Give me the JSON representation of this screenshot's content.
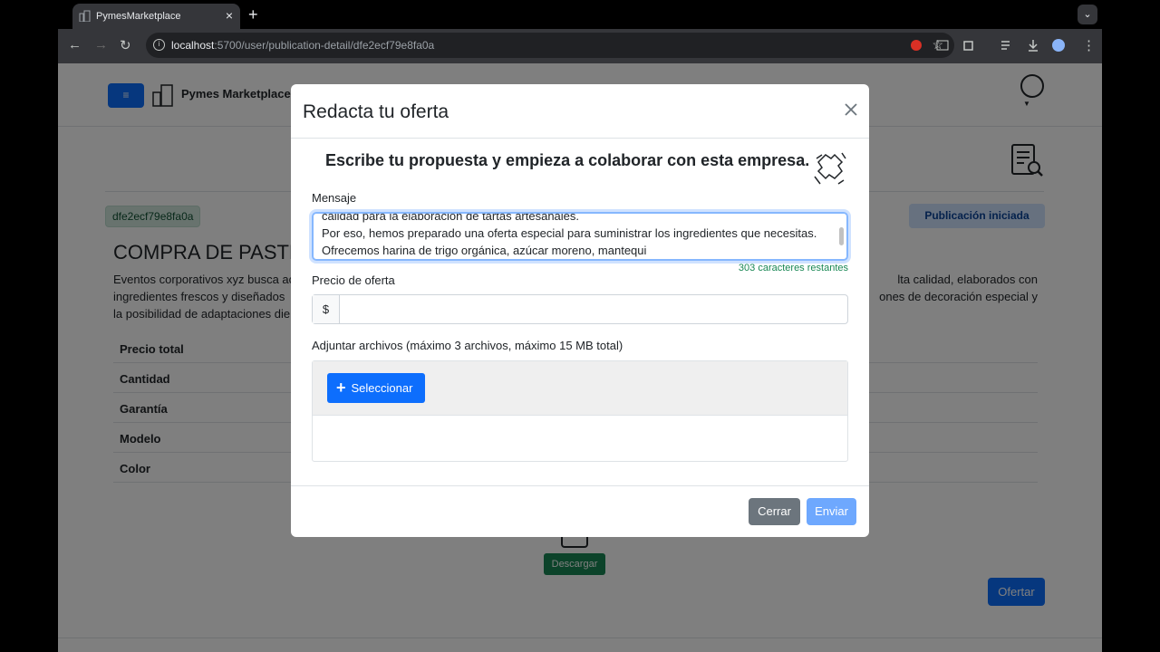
{
  "browser": {
    "tab_title": "PymesMarketplace",
    "url_host": "localhost",
    "url_path": ":5700/user/publication-detail/dfe2ecf79e8fa0a"
  },
  "app": {
    "brand": "Pymes Marketplace",
    "menu_icon": "≡"
  },
  "publication": {
    "id": "dfe2ecf79e8fa0a",
    "status": "Publicación iniciada",
    "title": "COMPRA DE PASTE",
    "description_left": "Eventos corporativos xyz busca ac",
    "description_left2": "ingredientes frescos y diseñados",
    "description_left3": "la posibilidad de adaptaciones die",
    "description_right": "lta calidad, elaborados con",
    "description_right2": "ones de decoración especial y",
    "specs": [
      "Precio total",
      "Cantidad",
      "Garantía",
      "Modelo",
      "Color"
    ],
    "download_label": "Descargar",
    "offer_label": "Ofertar"
  },
  "modal": {
    "title": "Redacta tu oferta",
    "subtitle": "Escribe tu propuesta y empieza a colaborar con esta empresa.",
    "message_label": "Mensaje",
    "message_value": "calidad para la elaboración de tartas artesanales.\nPor eso, hemos preparado una oferta especial para suministrar los ingredientes que necesitas.\nOfrecemos harina de trigo orgánica, azúcar moreno, mantequi",
    "chars_left": "303 caracteres restantes",
    "price_label": "Precio de oferta",
    "price_prefix": "$",
    "price_value": "",
    "attach_label": "Adjuntar archivos (máximo 3 archivos, máximo 15 MB total)",
    "select_label": "Seleccionar",
    "close_label": "Cerrar",
    "send_label": "Enviar"
  },
  "colors": {
    "primary": "#0d6efd",
    "success": "#198754",
    "secondary": "#6c757d",
    "send_disabled": "#6ea8fe"
  }
}
